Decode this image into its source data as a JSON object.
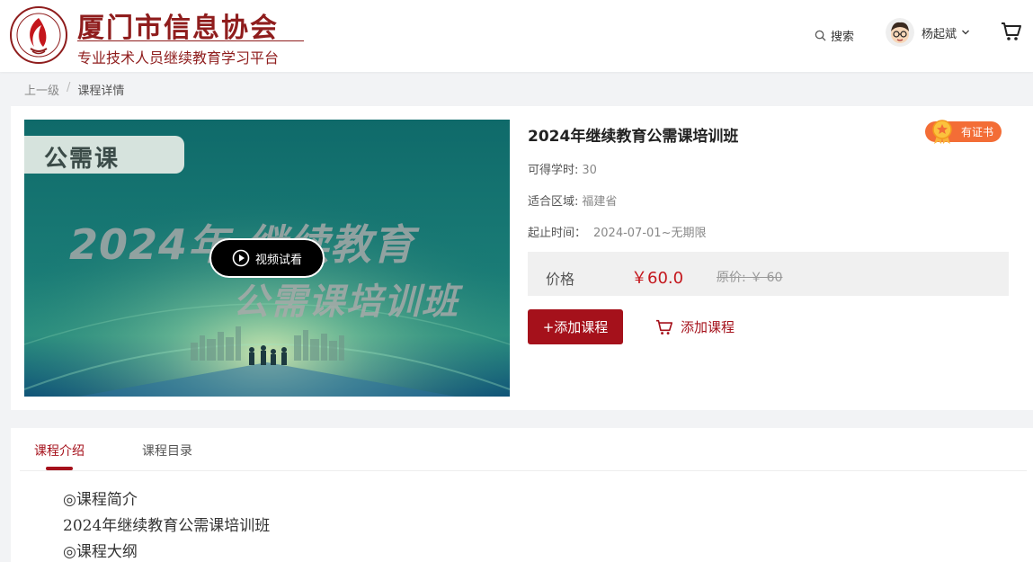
{
  "header": {
    "brand_title": "厦门市信息协会",
    "brand_subtitle": "专业技术人员继续教育学习平台",
    "search_label": "搜索",
    "user_name": "杨起斌"
  },
  "breadcrumb": {
    "parent": "上一级",
    "separator": "/",
    "current": "课程详情"
  },
  "video": {
    "tag": "公需课",
    "line1": "2024年 继续教育",
    "line2": "公需课培训班",
    "play_label": "视频试看"
  },
  "course": {
    "title": "2024年继续教育公需课培训班",
    "cert_badge": "有证书",
    "hours_label": "可得学时:",
    "hours_value": "30",
    "region_label": "适合区域:",
    "region_value": "福建省",
    "period_label": "起止时间：",
    "period_value": "2024-07-01~无期限",
    "price_label": "价格",
    "price_now": "￥60.0",
    "price_original": "原价: ￥ 60",
    "add_button": "+添加课程",
    "add_cart_button": "添加课程"
  },
  "tabs": [
    {
      "label": "课程介绍",
      "active": true
    },
    {
      "label": "课程目录",
      "active": false
    }
  ],
  "description": [
    "◎课程简介",
    "2024年继续教育公需课培训班",
    "◎课程大纲"
  ],
  "colors": {
    "brand": "#8f1d1d",
    "accent": "#a5111b",
    "price": "#c4161c",
    "badge": "#f36d36"
  }
}
